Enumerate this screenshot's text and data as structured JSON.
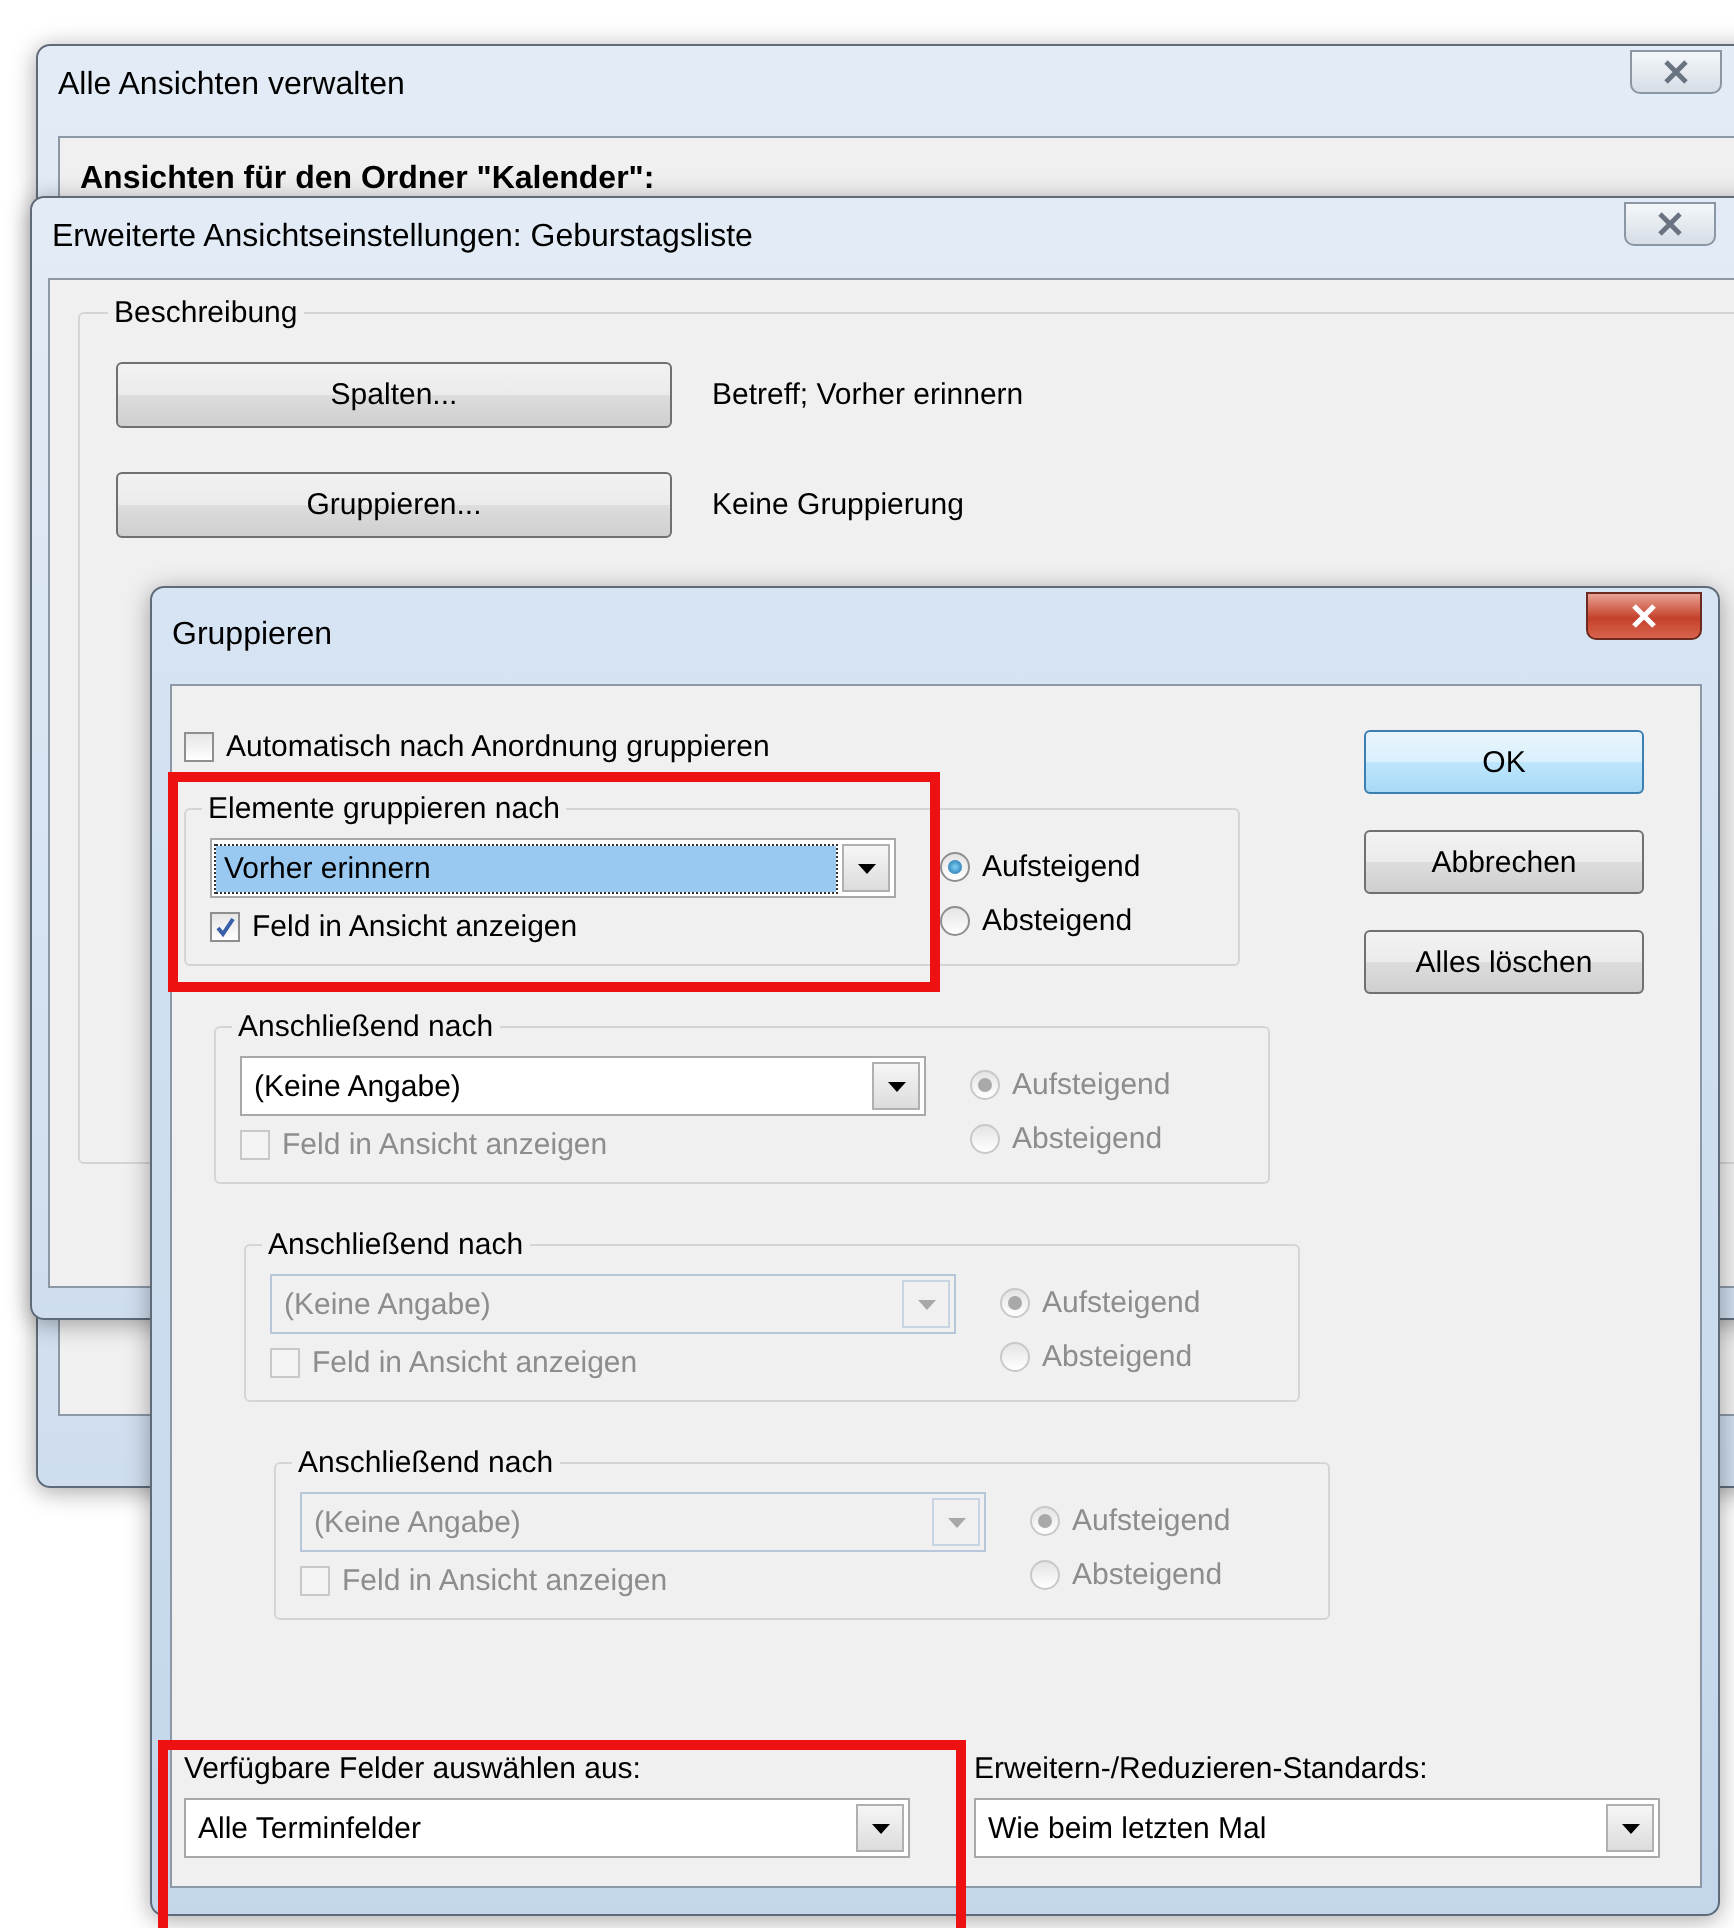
{
  "background_window": {
    "title": "Alle Ansichten verwalten",
    "folder_label": "Ansichten für den Ordner \"Kalender\":"
  },
  "view_settings_window": {
    "title": "Erweiterte Ansichtseinstellungen: Geburstagsliste",
    "group_label": "Beschreibung",
    "rows": [
      {
        "button": "Spalten...",
        "value": "Betreff; Vorher erinnern"
      },
      {
        "button": "Gruppieren...",
        "value": "Keine Gruppierung"
      }
    ]
  },
  "group_dialog": {
    "title": "Gruppieren",
    "auto_group": {
      "label": "Automatisch nach Anordnung gruppieren",
      "checked": false
    },
    "levels": [
      {
        "label": "Elemente gruppieren nach",
        "field": "Vorher erinnern",
        "field_selected": true,
        "field_disabled": false,
        "show_in_view": {
          "label": "Feld in Ansicht anzeigen",
          "checked": true,
          "disabled": false
        },
        "order_disabled": false,
        "order": [
          {
            "label": "Aufsteigend",
            "selected": true
          },
          {
            "label": "Absteigend",
            "selected": false
          }
        ]
      },
      {
        "label": "Anschließend nach",
        "field": "(Keine Angabe)",
        "field_selected": false,
        "field_disabled": false,
        "show_in_view": {
          "label": "Feld in Ansicht anzeigen",
          "checked": false,
          "disabled": true
        },
        "order_disabled": true,
        "order": [
          {
            "label": "Aufsteigend",
            "selected": true
          },
          {
            "label": "Absteigend",
            "selected": false
          }
        ]
      },
      {
        "label": "Anschließend nach",
        "field": "(Keine Angabe)",
        "field_selected": false,
        "field_disabled": true,
        "show_in_view": {
          "label": "Feld in Ansicht anzeigen",
          "checked": false,
          "disabled": true
        },
        "order_disabled": true,
        "order": [
          {
            "label": "Aufsteigend",
            "selected": true
          },
          {
            "label": "Absteigend",
            "selected": false
          }
        ]
      },
      {
        "label": "Anschließend nach",
        "field": "(Keine Angabe)",
        "field_selected": false,
        "field_disabled": true,
        "show_in_view": {
          "label": "Feld in Ansicht anzeigen",
          "checked": false,
          "disabled": true
        },
        "order_disabled": true,
        "order": [
          {
            "label": "Aufsteigend",
            "selected": true
          },
          {
            "label": "Absteigend",
            "selected": false
          }
        ]
      }
    ],
    "buttons": [
      {
        "label": "OK",
        "default": true
      },
      {
        "label": "Abbrechen",
        "default": false
      },
      {
        "label": "Alles löschen",
        "default": false
      }
    ],
    "available_fields": {
      "label": "Verfügbare Felder auswählen aus:",
      "value": "Alle Terminfelder"
    },
    "expand_defaults": {
      "label": "Erweitern-/Reduzieren-Standards:",
      "value": "Wie beim letzten Mal"
    }
  }
}
